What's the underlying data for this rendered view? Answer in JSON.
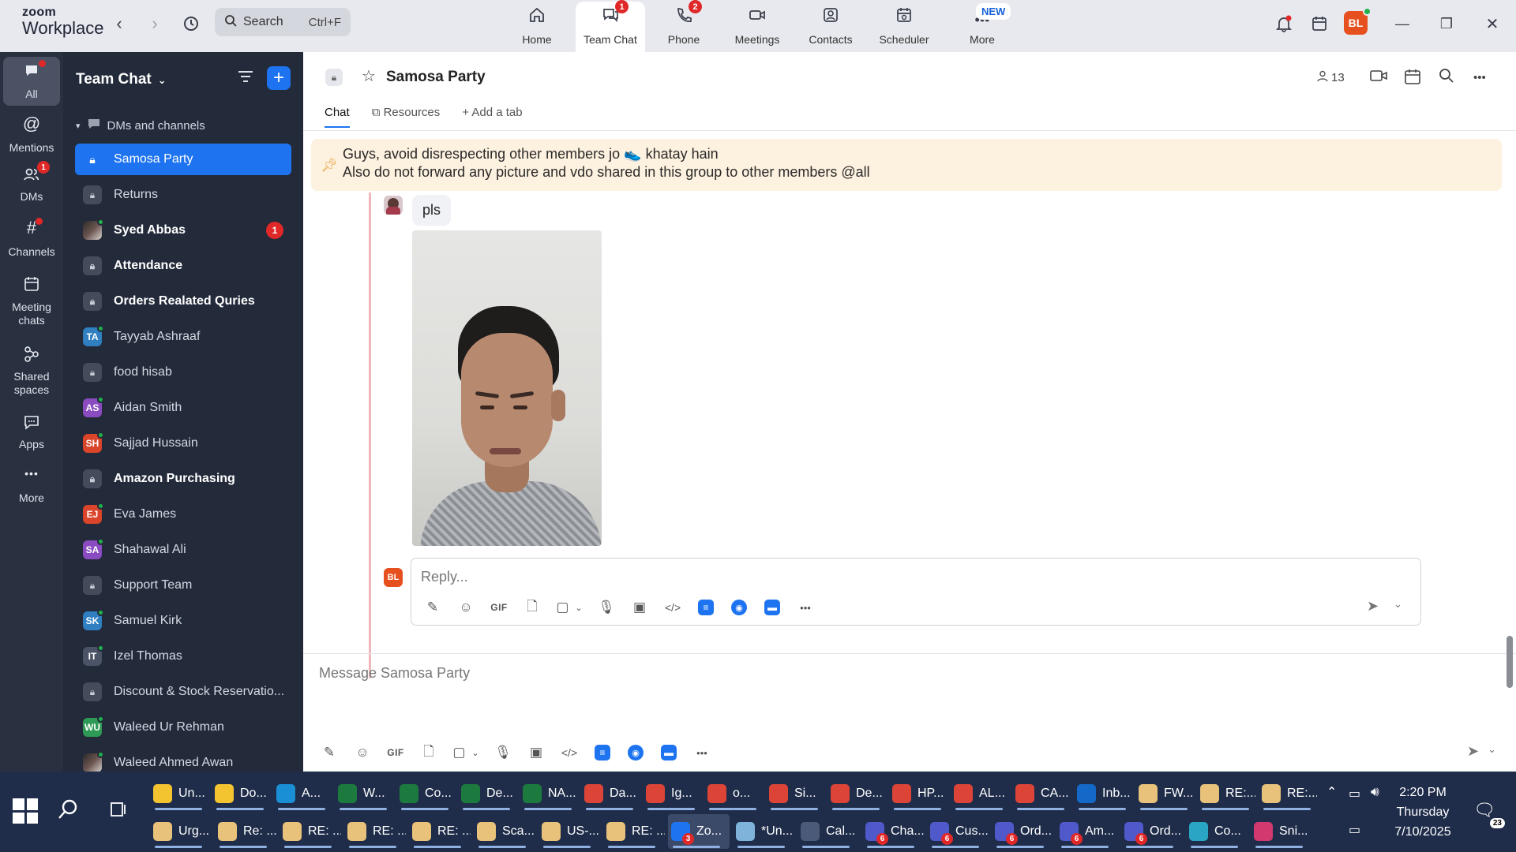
{
  "app": {
    "brand_line1": "zoom",
    "brand_line2": "Workplace"
  },
  "search": {
    "label": "Search",
    "shortcut": "Ctrl+F"
  },
  "nav": [
    {
      "label": "Home",
      "icon": "home-icon",
      "badge": ""
    },
    {
      "label": "Team Chat",
      "icon": "chat-icon",
      "badge": "1"
    },
    {
      "label": "Phone",
      "icon": "phone-icon",
      "badge": "2"
    },
    {
      "label": "Meetings",
      "icon": "video-icon",
      "badge": ""
    },
    {
      "label": "Contacts",
      "icon": "contacts-icon",
      "badge": ""
    },
    {
      "label": "Scheduler",
      "icon": "calendar-icon",
      "badge": ""
    },
    {
      "label": "More",
      "icon": "more-icon",
      "badge": ""
    }
  ],
  "more_new_badge": "NEW",
  "user_initials": "BL",
  "rail": [
    {
      "label": "All"
    },
    {
      "label": "Mentions"
    },
    {
      "label": "DMs",
      "badge": "1"
    },
    {
      "label": "Channels"
    },
    {
      "label": "Meeting chats"
    },
    {
      "label": "Shared spaces"
    },
    {
      "label": "Apps"
    },
    {
      "label": "More"
    }
  ],
  "sidebar": {
    "title": "Team Chat",
    "section": "DMs and channels",
    "items": [
      {
        "label": "Samosa Party",
        "type": "lock",
        "active": true,
        "bold": false,
        "badge": ""
      },
      {
        "label": "Returns",
        "type": "lock",
        "active": false,
        "bold": false,
        "badge": ""
      },
      {
        "label": "Syed Abbas",
        "type": "photo",
        "active": false,
        "bold": true,
        "badge": "1"
      },
      {
        "label": "Attendance",
        "type": "lock",
        "active": false,
        "bold": true,
        "badge": ""
      },
      {
        "label": "Orders Realated Quries",
        "type": "lock",
        "active": false,
        "bold": true,
        "badge": ""
      },
      {
        "label": "Tayyab Ashraaf",
        "type": "initials",
        "initials": "TA",
        "color": "#2f7fc1",
        "bold": false,
        "badge": ""
      },
      {
        "label": "food hisab",
        "type": "lock",
        "active": false,
        "bold": false,
        "badge": ""
      },
      {
        "label": "Aidan Smith",
        "type": "initials",
        "initials": "AS",
        "color": "#8a4cc0",
        "bold": false,
        "badge": ""
      },
      {
        "label": "Sajjad Hussain",
        "type": "initials",
        "initials": "SH",
        "color": "#d9442b",
        "bold": false,
        "badge": ""
      },
      {
        "label": "Amazon Purchasing",
        "type": "lock",
        "active": false,
        "bold": true,
        "badge": ""
      },
      {
        "label": "Eva James",
        "type": "initials",
        "initials": "EJ",
        "color": "#d9442b",
        "bold": false,
        "badge": ""
      },
      {
        "label": "Shahawal Ali",
        "type": "initials",
        "initials": "SA",
        "color": "#8a4cc0",
        "bold": false,
        "badge": ""
      },
      {
        "label": "Support Team",
        "type": "lock",
        "active": false,
        "bold": false,
        "badge": ""
      },
      {
        "label": "Samuel Kirk",
        "type": "initials",
        "initials": "SK",
        "color": "#2f7fc1",
        "bold": false,
        "badge": ""
      },
      {
        "label": "Izel Thomas",
        "type": "initials",
        "initials": "IT",
        "color": "#4b5366",
        "bold": false,
        "badge": ""
      },
      {
        "label": "Discount & Stock Reservatio...",
        "type": "lock",
        "active": false,
        "bold": false,
        "badge": ""
      },
      {
        "label": "Waleed Ur Rehman",
        "type": "initials",
        "initials": "WU",
        "color": "#2f9a55",
        "bold": false,
        "badge": ""
      },
      {
        "label": "Waleed Ahmed Awan",
        "type": "photo",
        "active": false,
        "bold": false,
        "badge": ""
      }
    ]
  },
  "channel": {
    "title": "Samosa Party",
    "member_count": "13",
    "tabs": [
      "Chat",
      "Resources",
      "Add a tab"
    ],
    "pinned_line1": "Guys, avoid disrespecting other members jo 👟 khatay hain",
    "pinned_line2": "Also do not forward any picture and vdo shared in this group to other members @all",
    "message_text": "pls",
    "reply_avatar": "BL",
    "reply_placeholder": "Reply...",
    "compose_placeholder": "Message Samosa Party"
  },
  "toolbar_gif": "GIF",
  "taskbar": {
    "row1": [
      {
        "label": "Un...",
        "color": "#f4c430"
      },
      {
        "label": "Do...",
        "color": "#f4c430"
      },
      {
        "label": "A...",
        "color": "#1b8fd6"
      },
      {
        "label": "W...",
        "color": "#1d7a3e"
      },
      {
        "label": "Co...",
        "color": "#1d7a3e"
      },
      {
        "label": "De...",
        "color": "#1d7a3e"
      },
      {
        "label": "NA...",
        "color": "#1d7a3e"
      },
      {
        "label": "Da...",
        "color": "#db4437"
      },
      {
        "label": "Ig...",
        "color": "#db4437"
      },
      {
        "label": "o...",
        "color": "#db4437"
      },
      {
        "label": "Si...",
        "color": "#db4437"
      },
      {
        "label": "De...",
        "color": "#db4437"
      },
      {
        "label": "HP...",
        "color": "#db4437"
      },
      {
        "label": "AL...",
        "color": "#db4437"
      },
      {
        "label": "CA...",
        "color": "#db4437"
      },
      {
        "label": "Inb...",
        "color": "#1468c8"
      },
      {
        "label": "FW...",
        "color": "#e8c27a"
      },
      {
        "label": "RE:...",
        "color": "#e8c27a"
      },
      {
        "label": "RE:...",
        "color": "#e8c27a"
      }
    ],
    "row2": [
      {
        "label": "Urg...",
        "color": "#e8c27a"
      },
      {
        "label": "Re: ...",
        "color": "#e8c27a"
      },
      {
        "label": "RE: ...",
        "color": "#e8c27a"
      },
      {
        "label": "RE: ...",
        "color": "#e8c27a"
      },
      {
        "label": "RE: ...",
        "color": "#e8c27a"
      },
      {
        "label": "Sca...",
        "color": "#e8c27a"
      },
      {
        "label": "US-...",
        "color": "#e8c27a"
      },
      {
        "label": "RE: ...",
        "color": "#e8c27a"
      },
      {
        "label": "Zo...",
        "color": "#1e74f0",
        "badge": "3"
      },
      {
        "label": "*Un...",
        "color": "#7fb3d9"
      },
      {
        "label": "Cal...",
        "color": "#4b5a78"
      },
      {
        "label": "Cha...",
        "color": "#5059c9",
        "badge": "6"
      },
      {
        "label": "Cus...",
        "color": "#5059c9",
        "badge": "6"
      },
      {
        "label": "Ord...",
        "color": "#5059c9",
        "badge": "6"
      },
      {
        "label": "Am...",
        "color": "#5059c9",
        "badge": "6"
      },
      {
        "label": "Ord...",
        "color": "#5059c9",
        "badge": "6"
      },
      {
        "label": "Co...",
        "color": "#2aa6c4"
      },
      {
        "label": "Sni...",
        "color": "#d23a6f"
      }
    ],
    "time": "2:20 PM",
    "day": "Thursday",
    "date": "7/10/2025",
    "notif_count": "23"
  }
}
